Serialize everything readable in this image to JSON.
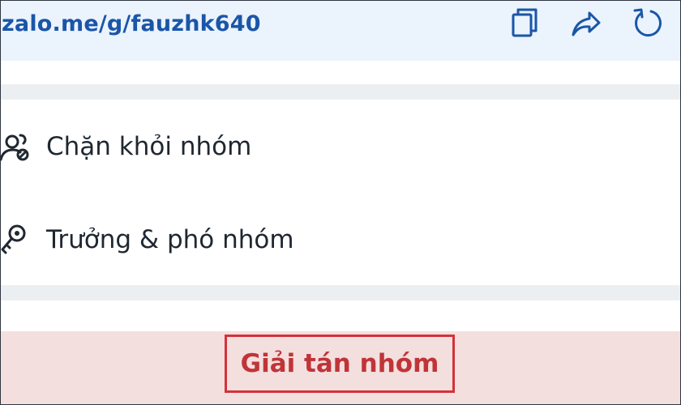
{
  "link_bar": {
    "link_text": "zalo.me/g/fauzhk640",
    "icons": [
      "copy-icon",
      "share-icon",
      "reset-icon"
    ]
  },
  "menu": {
    "items": [
      {
        "label": "Chặn khỏi nhóm",
        "icon": "users-block-icon"
      },
      {
        "label": "Trưởng & phó nhóm",
        "icon": "key-icon"
      }
    ]
  },
  "disband": {
    "label": "Giải tán nhóm"
  },
  "colors": {
    "accent": "#1a56a8",
    "link_bar_bg": "#ebf3fd",
    "danger": "#d2323a",
    "danger_bg": "#f4dfdf",
    "divider": "#eceff2"
  }
}
